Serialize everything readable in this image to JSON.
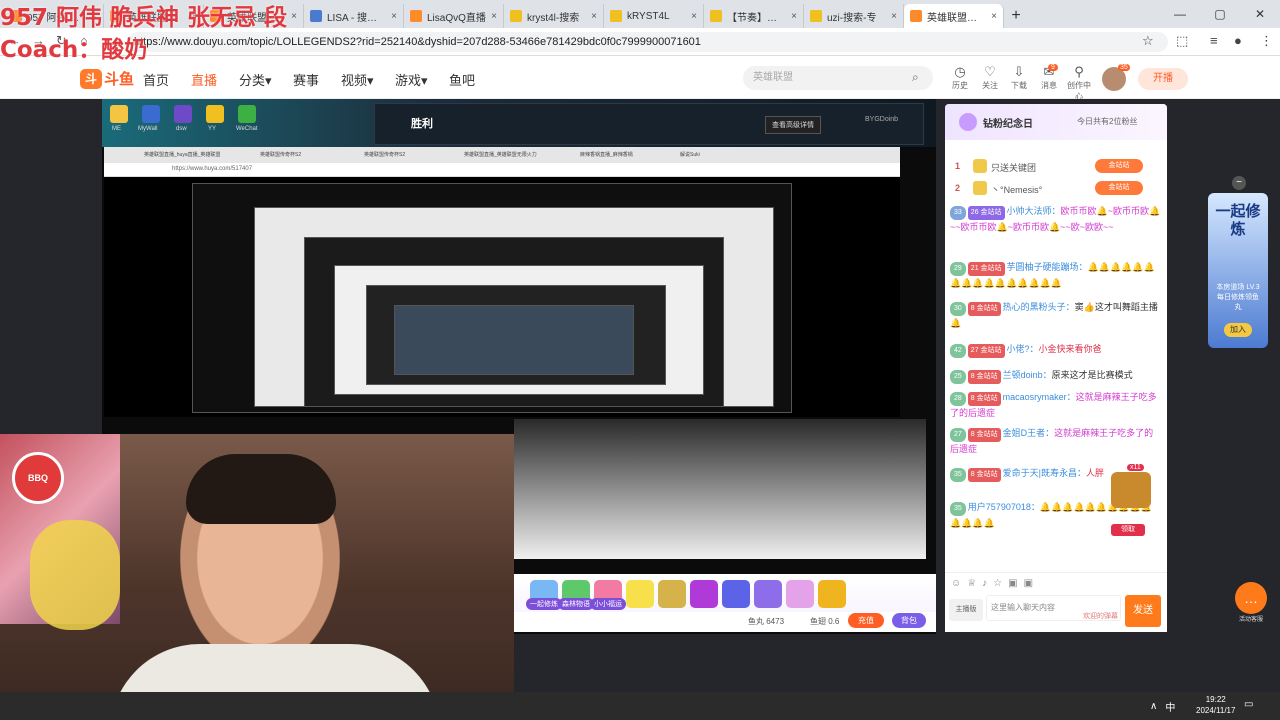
{
  "browser": {
    "tabs": [
      {
        "label": "957 阿伟 一起修炼",
        "active": false,
        "color": "#ff8a2b"
      },
      {
        "label": "英雄联盟直播",
        "active": false,
        "color": "#ff8a2b"
      },
      {
        "label": "英雄联盟直播",
        "active": false,
        "color": "#ff8a2b"
      },
      {
        "label": "LISA - 搜索结果",
        "active": false,
        "color": "#4a7bd1"
      },
      {
        "label": "LisaQvQ直播",
        "active": false,
        "color": "#ff8a2b"
      },
      {
        "label": "kryst4l-搜索",
        "active": false,
        "color": "#f0c020"
      },
      {
        "label": "kRYST4L",
        "active": false,
        "color": "#f0c020"
      },
      {
        "label": "【节奏】无畏",
        "active": false,
        "color": "#f0c020"
      },
      {
        "label": "uzi-搜索-专",
        "active": false,
        "color": "#f0c020"
      },
      {
        "label": "英雄联盟传奇",
        "active": true,
        "color": "#ff8a2b"
      }
    ],
    "new_tab": "+",
    "url": "https://www.douyu.com/topic/LOLLEGENDS2?rid=252140&dyshid=207d288-53466e781429bdc0f0c7999900071601"
  },
  "overlay": {
    "line1": "957 阿伟 脆兵神 张无忌 段",
    "line2": "Coach：酸奶"
  },
  "site": {
    "logo_mark": "斗",
    "logo_text": "斗鱼",
    "nav": [
      "首页",
      "直播",
      "分类▾",
      "赛事",
      "视频▾",
      "游戏▾",
      "鱼吧"
    ],
    "nav_current": 1,
    "search_placeholder": "英雄联盟",
    "header_icons": [
      {
        "glyph": "◷",
        "label": "历史"
      },
      {
        "glyph": "♡",
        "label": "关注"
      },
      {
        "glyph": "⇩",
        "label": "下载"
      },
      {
        "glyph": "✉",
        "label": "消息"
      },
      {
        "glyph": "⚲",
        "label": "创作中心"
      }
    ],
    "message_badge": "9",
    "avatar_level": "35",
    "go_live": "开播"
  },
  "stream": {
    "victory_text": "胜利",
    "victory_btn": "查看高级详情",
    "player_name": "BYGDoinb",
    "desktop_icons": [
      "ME",
      "MyWall",
      "dsw",
      "YY",
      "WeChat"
    ],
    "nested_url": "https://www.huya.com/517407",
    "nested_tabs": [
      "英雄联盟直播_huya直播_英雄联盟",
      "英雄联盟传奇杯S2",
      "英雄联盟传奇杯S2",
      "英雄联盟直播_英雄联盟无限火力",
      "麻辣香锅直播_麻辣香锅",
      "解说Suki"
    ],
    "cam_badge": "BBQ"
  },
  "gifts": {
    "items": [
      {
        "label": "一起修炼",
        "color": "#7ab8f5"
      },
      {
        "label": "森林物语",
        "color": "#5ec96b"
      },
      {
        "label": "小小福运",
        "color": "#f27aa3"
      },
      {
        "label": "",
        "color": "#f7e04a"
      },
      {
        "label": "",
        "color": "#d6b24a"
      },
      {
        "label": "",
        "color": "#b03ad8"
      },
      {
        "label": "",
        "color": "#5b63e6"
      },
      {
        "label": "",
        "color": "#8d6ee8"
      },
      {
        "label": "",
        "color": "#e4a2e8"
      },
      {
        "label": "",
        "color": "#f0b41e"
      }
    ],
    "fish_balls": "鱼丸 6473",
    "fish_fin": "鱼翅 0.6",
    "charge": "充值",
    "bag": "背包"
  },
  "chat": {
    "fanday_title": "钻粉纪念日",
    "fanday_right": "今日共有2位粉丝",
    "ranks": [
      {
        "n": "1",
        "name": "只送关键团",
        "tag": "金站站"
      },
      {
        "n": "2",
        "name": "丶°Nemesis°",
        "tag": "金站站"
      }
    ],
    "messages": [
      {
        "lv": "33",
        "fb": "26 金站站",
        "user": "小帅大法师：",
        "text": "欧币币欧🔔~欧币币欧🔔~~欧币币欧🔔~欧币币欧🔔~~欧~欧欧~~",
        "tcls": "pk"
      },
      {
        "lv": "29",
        "fb": "21 金站站",
        "user": "芋圆柚子硬能蹦场：",
        "text": "🔔🔔🔔🔔🔔🔔🔔🔔🔔🔔🔔🔔🔔🔔🔔🔔",
        "tcls": "r"
      },
      {
        "lv": "30",
        "fb": "8 金站站",
        "user": "热心的黑粉头子：",
        "text": "窦👍这才叫舞蹈主播🔔",
        "tcls": ""
      },
      {
        "lv": "42",
        "fb": "27 金站站",
        "user": "小佬?：",
        "text": "小金快来看你爸",
        "tcls": "r"
      },
      {
        "lv": "25",
        "fb": "8 金站站",
        "user": "兰顿doinb：",
        "text": "原来这才是比赛模式",
        "tcls": ""
      },
      {
        "lv": "28",
        "fb": "8 金站站",
        "user": "macaosrymaker：",
        "text": "这就是麻辣王子吃多了的后遗症",
        "tcls": "pk"
      },
      {
        "lv": "27",
        "fb": "8 金站站",
        "user": "金姐D王者：",
        "text": "这就是麻辣王子吃多了的后遗症",
        "tcls": "pk"
      },
      {
        "lv": "35",
        "fb": "8 金站站",
        "user": "爱命于天|既寿永昌：",
        "text": "人胖",
        "tcls": "r"
      },
      {
        "lv": "35",
        "fb": "",
        "user": "用户757907018：",
        "text": "🔔🔔🔔🔔🔔🔔🔔🔔🔔🔔🔔🔔🔔🔔",
        "tcls": "r"
      }
    ],
    "chest_count": "x11",
    "chest_btn": "领取",
    "input_placeholder": "这里输入聊天内容",
    "input_hint": "欢迎的弹幕",
    "mode": "主播版",
    "send": "发送"
  },
  "side_ad": {
    "title": "一起修炼",
    "sub": "本房道场 LV.3 每日修炼领鱼丸",
    "add": "加入",
    "cs": "活动客服"
  },
  "taskbar": {
    "ime": "中",
    "time": "19:22",
    "date": "2024/11/17"
  }
}
